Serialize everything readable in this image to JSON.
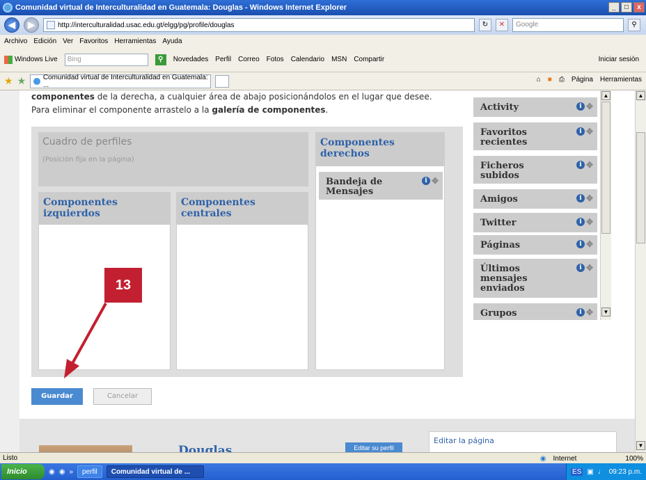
{
  "window": {
    "title": "Comunidad virtual de Interculturalidad en Guatemala: Douglas - Windows Internet Explorer",
    "minimize": "_",
    "maximize": "□",
    "close": "x"
  },
  "address_bar": {
    "url": "http://interculturalidad.usac.edu.gt/elgg/pg/profile/douglas",
    "search_placeholder": "Google"
  },
  "menu": [
    "Archivo",
    "Edición",
    "Ver",
    "Favoritos",
    "Herramientas",
    "Ayuda"
  ],
  "windows_live": {
    "label": "Windows Live",
    "search_placeholder": "Bing",
    "links": [
      "Novedades",
      "Perfil",
      "Correo",
      "Fotos",
      "Calendario",
      "MSN",
      "Compartir"
    ],
    "signin": "Iniciar sesión"
  },
  "tab": {
    "title": "Comunidad virtual de Interculturalidad en Guatemala: ...",
    "tools": [
      "Página",
      "Herramientas"
    ]
  },
  "page": {
    "intro_line1_bold": "componentes",
    "intro_line1_rest": " de la derecha, a cualquier área de abajo posicionándolos en el lugar que desee.",
    "intro_line2_start": "Para eliminar el componente arrastelo a la ",
    "intro_line2_bold": "galería de componentes",
    "intro_line2_end": ".",
    "profile_box_title": "Cuadro de perfiles",
    "profile_box_sub": "(Posición fija en la página)",
    "col_left": "Componentes izquierdos",
    "col_center": "Componentes centrales",
    "col_right": "Componentes derechos",
    "right_widget": "Bandeja de Mensajes",
    "side_widgets": [
      "Activity",
      "Favoritos recientes",
      "Ficheros subidos",
      "Amigos",
      "Twitter",
      "Páginas",
      "Últimos mensajes enviados",
      "Grupos"
    ],
    "save": "Guardar",
    "cancel": "Cancelar",
    "profile_name": "Douglas",
    "edit_profile": "Editar su perfil",
    "edit_page": "Editar la página"
  },
  "annotation": {
    "badge": "13",
    "color": "#c22030"
  },
  "status": {
    "text": "Listo",
    "zone": "Internet",
    "zoom": "100%"
  },
  "taskbar": {
    "start": "Inicio",
    "items": [
      "perfil",
      "Comunidad virtual de ..."
    ],
    "lang": "ES",
    "clock": "09:23 p.m."
  }
}
